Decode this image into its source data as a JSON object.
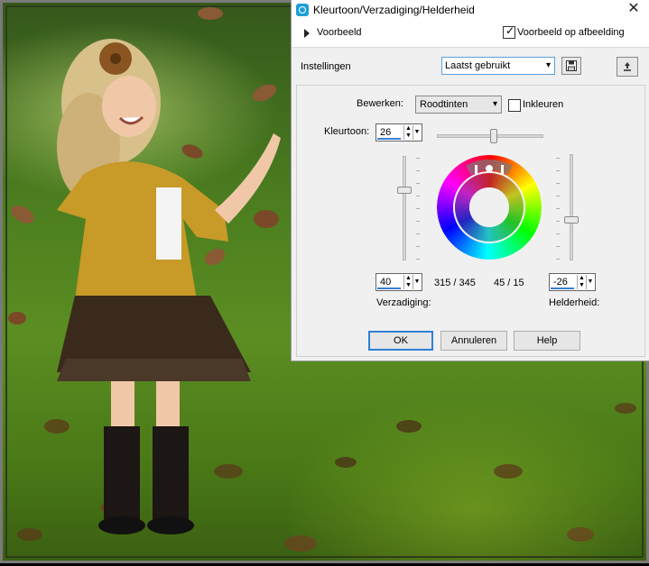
{
  "dialog": {
    "title": "Kleurtoon/Verzadiging/Helderheid",
    "close_glyph": "✕",
    "preview": {
      "label": "Voorbeeld",
      "on_image_label": "Voorbeeld op afbeelding",
      "on_image_checked": true
    },
    "settings": {
      "label": "Instellingen",
      "preset_value": "Laatst gebruikt"
    },
    "edit": {
      "label": "Bewerken:",
      "mode_value": "Roodtinten",
      "colorize_label": "Inkleuren",
      "colorize_checked": false
    },
    "hue": {
      "label": "Kleurtoon:",
      "value": "26"
    },
    "saturation": {
      "label": "Verzadiging:",
      "value": "40"
    },
    "lightness": {
      "label": "Helderheid:",
      "value": "-26"
    },
    "range_outer": "315 / 345",
    "range_inner": "45 / 15",
    "buttons": {
      "ok": "OK",
      "cancel": "Annuleren",
      "help": "Help"
    }
  },
  "icons": {
    "app": "app-icon",
    "close": "close-icon",
    "expand": "triangle-right-icon",
    "save_preset": "floppy-disk-icon",
    "reset": "reset-icon"
  },
  "colors": {
    "accent": "#2f7fd7",
    "dialog_bg": "#f0f0f0",
    "canvas_green": "#4b7d1f"
  }
}
